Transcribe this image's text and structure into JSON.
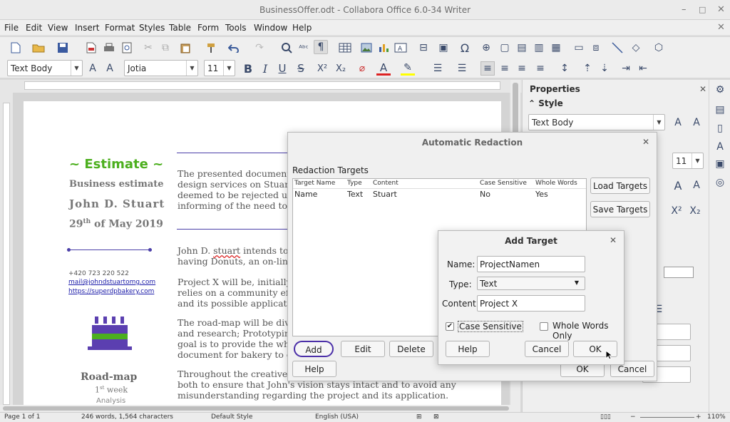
{
  "window": {
    "title": "BusinessOffer.odt - Collabora Office 6.0-34 Writer",
    "minimize": "–",
    "maximize": "□",
    "close": "✕",
    "doc_close": "✕"
  },
  "menu": [
    "File",
    "Edit",
    "View",
    "Insert",
    "Format",
    "Styles",
    "Table",
    "Form",
    "Tools",
    "Window",
    "Help"
  ],
  "format_bar": {
    "para_style": "Text Body",
    "font_name": "Jotia",
    "font_size": "11"
  },
  "properties": {
    "title": "Properties",
    "style_section": "Style",
    "style_value": "Text Body",
    "size_value": "11"
  },
  "document": {
    "estimate": "~ Estimate ~",
    "business_estimate": "Business estimate",
    "author": "John D. Stuart",
    "date_day": "29",
    "date_sup": "th",
    "date_rest": " of May 2019",
    "phone": "+420 723 220 522",
    "email": "mail@johndstuartomg.com",
    "website": "https://superdpbakery.com",
    "roadmap": "Road-map",
    "week_num": "1",
    "week_sup": "st",
    "week_rest": " week",
    "analysis": "Analysis",
    "p1": [
      "The presented document in",
      "design services on Stuart's",
      "deemed to be rejected unle",
      "informing of the need to ac"
    ],
    "p2_a": "John D. ",
    "p2_b": "stuart",
    "p2_c": " intends to pr",
    "p2_d": "having Donuts, an on-line s",
    "p3": [
      "Project X will be, initially, c",
      "relies on a community effor",
      "and its possible application"
    ],
    "p4": [
      "The road-map will be divid",
      "and research; Prototyping a",
      "goal is to provide the whol",
      "document for bakery to cor"
    ],
    "p5": [
      "Throughout the creative pr",
      "both to ensure that John's vision stays intact and to avoid any",
      "misunderstanding regarding the project and its application."
    ]
  },
  "redaction_dialog": {
    "title": "Automatic Redaction",
    "close": "✕",
    "targets_label": "Redaction Targets",
    "columns": [
      "Target Name",
      "Type",
      "Content",
      "Case Sensitive",
      "Whole Words"
    ],
    "rows": [
      {
        "name": "Name",
        "type": "Text",
        "content": "Stuart",
        "case_sensitive": "No",
        "whole_words": "Yes"
      }
    ],
    "load_targets": "Load Targets",
    "save_targets": "Save Targets",
    "add": "Add",
    "edit": "Edit",
    "delete": "Delete",
    "help": "Help",
    "ok": "OK",
    "cancel": "Cancel"
  },
  "add_target": {
    "title": "Add Target",
    "close": "✕",
    "name_label": "Name:",
    "name_value": "ProjectNamen",
    "type_label": "Type:",
    "type_value": "Text",
    "content_label": "Content:",
    "content_value": "Project X",
    "case_sensitive": "Case Sensitive",
    "case_checked": "✔",
    "whole_words": "Whole Words Only",
    "help": "Help",
    "cancel": "Cancel",
    "ok": "OK"
  },
  "status": {
    "page": "Page 1 of 1",
    "words": "246 words, 1,564 characters",
    "style": "Default Style",
    "language": "English (USA)",
    "zoom": "110%"
  },
  "colors": {
    "accent_green": "#4caf1e",
    "accent_purple": "#4b3fa8",
    "link_blue": "#1a1aa8"
  }
}
